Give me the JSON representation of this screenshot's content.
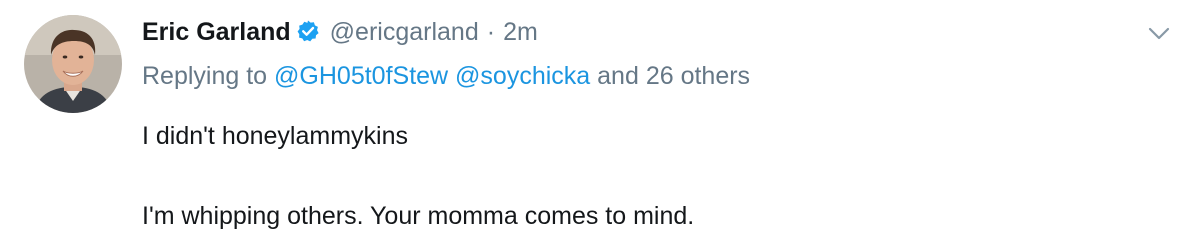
{
  "tweet": {
    "author": {
      "display_name": "Eric Garland",
      "handle": "@ericgarland",
      "verified": true,
      "avatar_icon": "user-avatar-photo"
    },
    "separator": "·",
    "time": "2m",
    "replying": {
      "prefix": "Replying to",
      "mentions": [
        "@GH05t0fStew",
        "@soychicka"
      ],
      "suffix": "and 26 others"
    },
    "text_lines": [
      "I didn't honeylammykins",
      "I'm whipping others. Your momma comes to mind."
    ],
    "menu_icon": "chevron-down-icon"
  },
  "colors": {
    "name": "#14171a",
    "secondary": "#657786",
    "link": "#1b95e0",
    "verified_badge": "#1da1f2"
  }
}
